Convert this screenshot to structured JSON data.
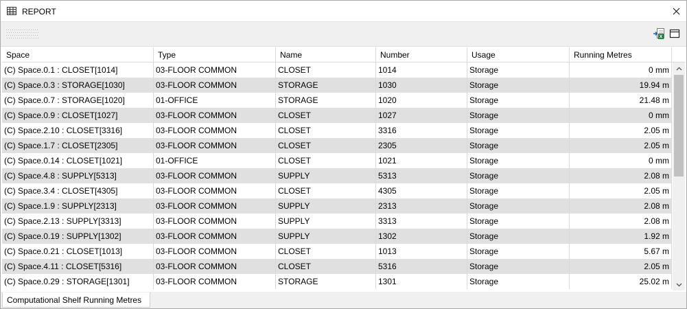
{
  "window": {
    "title": "REPORT",
    "icon": "table-icon",
    "close_icon": "close-icon"
  },
  "toolbar": {
    "buttons": [
      {
        "name": "export-excel-button",
        "icon": "export-excel-icon"
      },
      {
        "name": "layout-button",
        "icon": "window-layout-icon"
      }
    ]
  },
  "table": {
    "columns": [
      "Space",
      "Type",
      "Name",
      "Number",
      "Usage",
      "Running Metres"
    ],
    "rows": [
      [
        "(C) Space.0.1 : CLOSET[1014]",
        "03-FLOOR COMMON",
        "CLOSET",
        "1014",
        "Storage",
        "0 mm"
      ],
      [
        "(C) Space.0.3 : STORAGE[1030]",
        "03-FLOOR COMMON",
        "STORAGE",
        "1030",
        "Storage",
        "19.94 m"
      ],
      [
        "(C) Space.0.7 : STORAGE[1020]",
        "01-OFFICE",
        "STORAGE",
        "1020",
        "Storage",
        "21.48 m"
      ],
      [
        "(C) Space.0.9 : CLOSET[1027]",
        "03-FLOOR COMMON",
        "CLOSET",
        "1027",
        "Storage",
        "0 mm"
      ],
      [
        "(C) Space.2.10 : CLOSET[3316]",
        "03-FLOOR COMMON",
        "CLOSET",
        "3316",
        "Storage",
        "2.05 m"
      ],
      [
        "(C) Space.1.7 : CLOSET[2305]",
        "03-FLOOR COMMON",
        "CLOSET",
        "2305",
        "Storage",
        "2.05 m"
      ],
      [
        "(C) Space.0.14 : CLOSET[1021]",
        "01-OFFICE",
        "CLOSET",
        "1021",
        "Storage",
        "0 mm"
      ],
      [
        "(C) Space.4.8 : SUPPLY[5313]",
        "03-FLOOR COMMON",
        "SUPPLY",
        "5313",
        "Storage",
        "2.08 m"
      ],
      [
        "(C) Space.3.4 : CLOSET[4305]",
        "03-FLOOR COMMON",
        "CLOSET",
        "4305",
        "Storage",
        "2.05 m"
      ],
      [
        "(C) Space.1.9 : SUPPLY[2313]",
        "03-FLOOR COMMON",
        "SUPPLY",
        "2313",
        "Storage",
        "2.08 m"
      ],
      [
        "(C) Space.2.13 : SUPPLY[3313]",
        "03-FLOOR COMMON",
        "SUPPLY",
        "3313",
        "Storage",
        "2.08 m"
      ],
      [
        "(C) Space.0.19 : SUPPLY[1302]",
        "03-FLOOR COMMON",
        "SUPPLY",
        "1302",
        "Storage",
        "1.92 m"
      ],
      [
        "(C) Space.0.21 : CLOSET[1013]",
        "03-FLOOR COMMON",
        "CLOSET",
        "1013",
        "Storage",
        "5.67 m"
      ],
      [
        "(C) Space.4.11 : CLOSET[5316]",
        "03-FLOOR COMMON",
        "CLOSET",
        "5316",
        "Storage",
        "2.05 m"
      ],
      [
        "(C) Space.0.29 : STORAGE[1301]",
        "03-FLOOR COMMON",
        "STORAGE",
        "1301",
        "Storage",
        "25.02 m"
      ]
    ]
  },
  "bottom_tabs": [
    "Computational Shelf Running Metres"
  ],
  "colors": {
    "alt_row": "#e0e0e0",
    "toolbar_bg": "#f0f0f0",
    "excel_green": "#1f7a3a"
  }
}
